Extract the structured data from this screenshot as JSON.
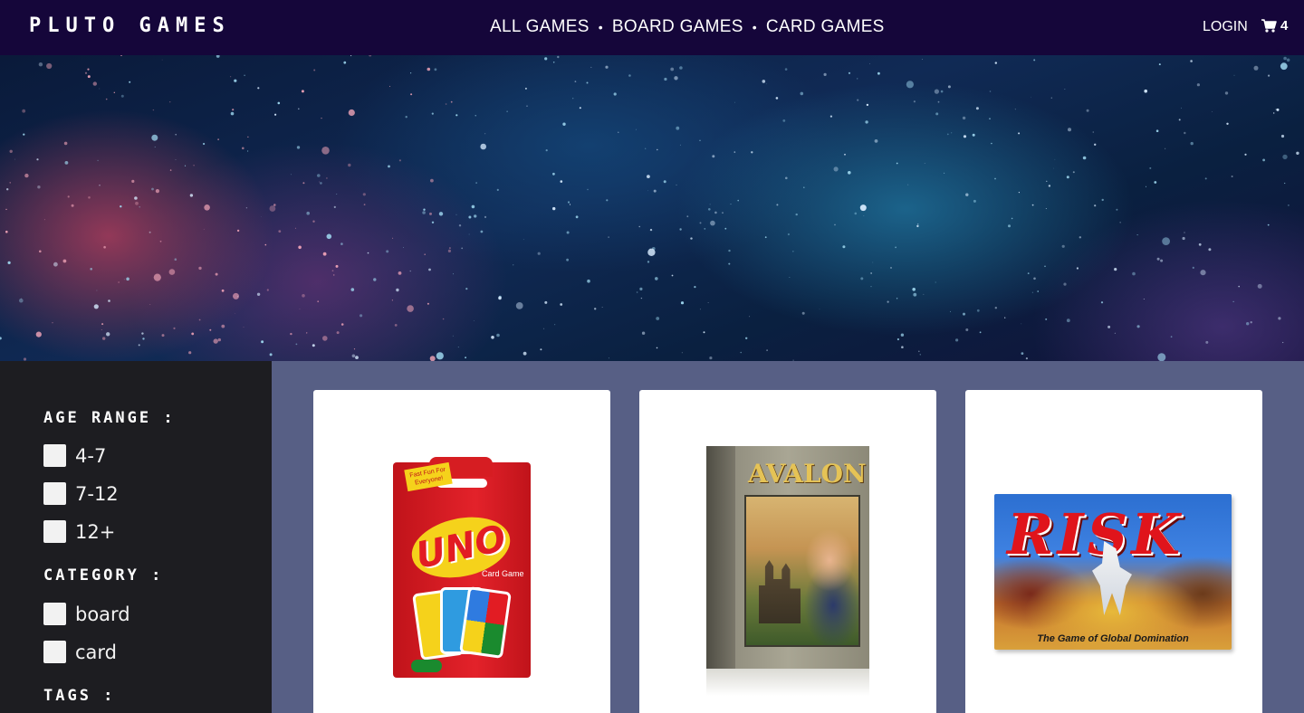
{
  "brand": "PLUTO GAMES",
  "nav": {
    "links": [
      "ALL GAMES",
      "BOARD GAMES",
      "CARD GAMES"
    ],
    "separator": "•",
    "login": "LOGIN",
    "cart_count": "4"
  },
  "filters": {
    "age_title": "AGE RANGE :",
    "age_options": [
      "4-7",
      "7-12",
      "12+"
    ],
    "category_title": "CATEGORY :",
    "category_options": [
      "board",
      "card"
    ],
    "tags_title": "TAGS :"
  },
  "products": [
    {
      "name": "UNO",
      "box_sub": "Card Game",
      "flag": "Fast Fun For Everyone!"
    },
    {
      "name": "AVALON"
    },
    {
      "name": "RISK",
      "tagline": "The Game of Global Domination"
    }
  ],
  "colors": {
    "navbar": "#15063a",
    "sidebar": "#1d1d21",
    "main_bg": "#575f85",
    "card_bg": "#ffffff"
  }
}
